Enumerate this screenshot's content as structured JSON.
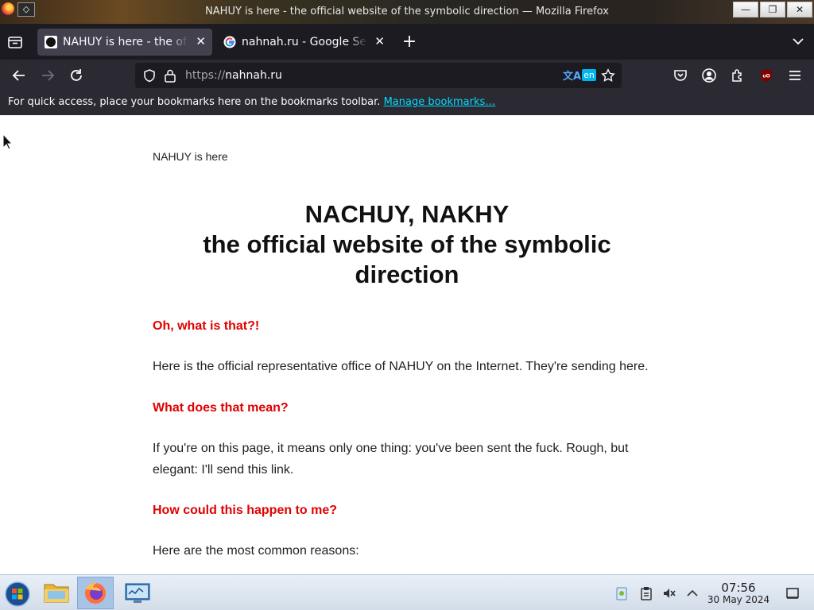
{
  "window": {
    "title": "NAHUY is here - the official website of the symbolic direction — Mozilla Firefox"
  },
  "tabs": [
    {
      "label": "NAHUY is here - the official website of the symbolic direction",
      "active": true,
      "favicon": "dark-circle-favicon"
    },
    {
      "label": "nahnah.ru - Google Search",
      "active": false,
      "favicon": "google-g-favicon"
    }
  ],
  "urlbar": {
    "protocol": "https://",
    "host": "nahnah.ru",
    "translate_lang": "en"
  },
  "bookmarks_bar": {
    "message": "For quick access, place your bookmarks here on the bookmarks toolbar. ",
    "link": "Manage bookmarks…"
  },
  "page": {
    "header_small": "NAHUY is here",
    "title_line1": "NACHUY, NAKHY",
    "title_line2": "the official website of the symbolic direction",
    "sections": [
      {
        "heading": "Oh, what is that?!",
        "text": "Here is the official representative office of NAHUY on the Internet. They're sending here."
      },
      {
        "heading": "What does that mean?",
        "text": "If you're on this page, it means only one thing: you've been sent the fuck. Rough, but elegant: I'll send this link."
      },
      {
        "heading": "How could this happen to me?",
        "text": "Here are the most common reasons:"
      }
    ],
    "heading_color": "#e00000"
  },
  "taskbar": {
    "clock_time": "07:56",
    "clock_date": "30 May 2024",
    "apps": [
      "start-orb-icon",
      "file-manager-icon",
      "firefox-icon",
      "system-monitor-icon"
    ]
  }
}
